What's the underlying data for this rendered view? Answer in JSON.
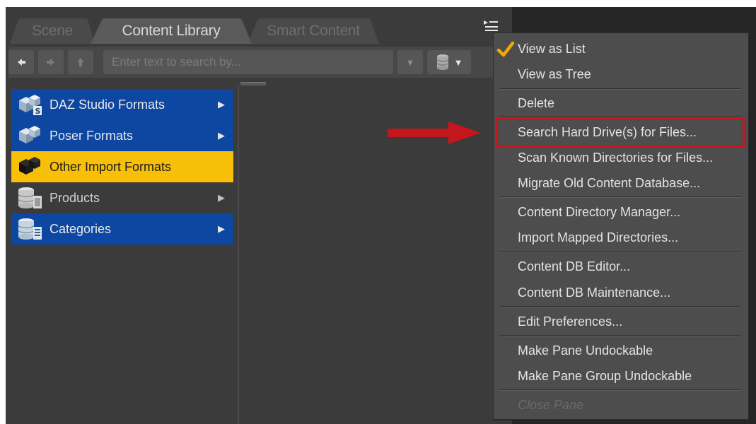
{
  "tabs": [
    {
      "label": "Scene",
      "active": false
    },
    {
      "label": "Content Library",
      "active": true
    },
    {
      "label": "Smart Content",
      "active": false
    }
  ],
  "toolbar": {
    "back_icon": "arrow-left-icon",
    "forward_icon": "arrow-right-icon",
    "up_icon": "arrow-up-icon",
    "search_placeholder": "Enter text to search by...",
    "search_value": "",
    "database_icon": "database-icon"
  },
  "tree": {
    "items": [
      {
        "label": "DAZ Studio Formats",
        "style": "blue",
        "has_submenu": true,
        "icon": "daz-format-icon"
      },
      {
        "label": "Poser Formats",
        "style": "blue",
        "has_submenu": true,
        "icon": "poser-format-icon"
      },
      {
        "label": "Other Import Formats",
        "style": "gold",
        "has_submenu": false,
        "icon": "import-format-icon"
      },
      {
        "label": "Products",
        "style": "plain",
        "has_submenu": true,
        "icon": "products-icon"
      },
      {
        "label": "Categories",
        "style": "blue",
        "has_submenu": true,
        "icon": "categories-icon"
      }
    ]
  },
  "menu": {
    "items": [
      {
        "label": "View as List",
        "checked": true
      },
      {
        "label": "View as Tree",
        "checked": false
      },
      {
        "label": "Delete"
      },
      {
        "label": "Search Hard Drive(s) for Files...",
        "highlighted": true
      },
      {
        "label": "Scan Known Directories for Files..."
      },
      {
        "label": "Migrate Old Content Database..."
      },
      {
        "label": "Content Directory Manager..."
      },
      {
        "label": "Import Mapped Directories..."
      },
      {
        "label": "Content DB Editor..."
      },
      {
        "label": "Content DB Maintenance..."
      },
      {
        "label": "Edit Preferences..."
      },
      {
        "label": "Make Pane Undockable"
      },
      {
        "label": "Make Pane Group Undockable"
      },
      {
        "label": "Close Pane",
        "disabled": true
      }
    ]
  },
  "colors": {
    "highlight_border": "#c4161c",
    "selected_item": "#f7bf08",
    "blue_item": "#0d47a1",
    "check": "#f2a900"
  }
}
